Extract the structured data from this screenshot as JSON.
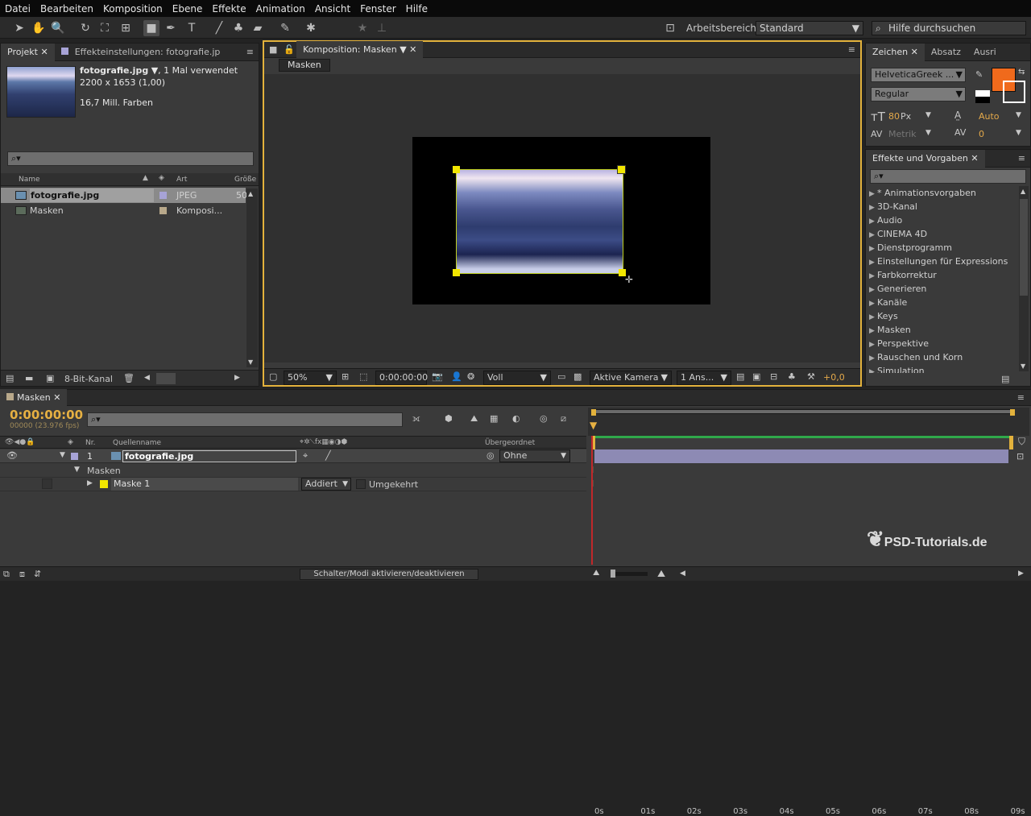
{
  "menu": [
    "Datei",
    "Bearbeiten",
    "Komposition",
    "Ebene",
    "Effekte",
    "Animation",
    "Ansicht",
    "Fenster",
    "Hilfe"
  ],
  "toolbar": {
    "workspace_label": "Arbeitsbereich:",
    "workspace_value": "Standard",
    "help_search_placeholder": "Hilfe durchsuchen"
  },
  "project": {
    "tab_label": "Projekt",
    "effects_tab_label": "Effekteinstellungen: fotografie.jp",
    "file_name": "fotografie.jpg",
    "usage": ", 1 Mal verwendet",
    "dimensions": "2200 x 1653 (1,00)",
    "colors": "16,7 Mill. Farben",
    "columns": {
      "name": "Name",
      "type": "Art",
      "size": "Größe"
    },
    "items": [
      {
        "name": "fotografie.jpg",
        "type": "JPEG",
        "size": "50",
        "color": "#a7a3d6"
      },
      {
        "name": "Masken",
        "type": "Komposi...",
        "size": "",
        "color": "#b8a88a"
      }
    ],
    "bit_depth": "8-Bit-Kanal"
  },
  "composition": {
    "tab_label": "Komposition: Masken",
    "breadcrumb": "Masken",
    "zoom": "50%",
    "timecode": "0:00:00:00",
    "resolution": "Voll",
    "camera": "Aktive Kamera",
    "views": "1 Ans...",
    "exposure": "+0,0"
  },
  "character": {
    "tabs": [
      "Zeichen",
      "Absatz",
      "Ausri"
    ],
    "font": "HelveticaGreek ...",
    "style": "Regular",
    "size": "80",
    "size_unit": "Px",
    "leading": "Auto",
    "kerning": "Metrik",
    "tracking": "0",
    "fill_color": "#f06a1c"
  },
  "effects": {
    "tab_label": "Effekte und Vorgaben",
    "items": [
      "* Animationsvorgaben",
      "3D-Kanal",
      "Audio",
      "CINEMA 4D",
      "Dienstprogramm",
      "Einstellungen für Expressions",
      "Farbkorrektur",
      "Generieren",
      "Kanäle",
      "Keys",
      "Masken",
      "Perspektive",
      "Rauschen und Korn",
      "Simulation"
    ]
  },
  "timeline": {
    "tab_label": "Masken",
    "timecode": "0:00:00:00",
    "frame_info": "00000 (23.976 fps)",
    "col_nr": "Nr.",
    "col_source": "Quellenname",
    "col_parent": "Übergeordnet",
    "layer_nr": "1",
    "layer_name": "fotografie.jpg",
    "parent_value": "Ohne",
    "masks_group": "Masken",
    "mask_name": "Maske 1",
    "mask_mode": "Addiert",
    "mask_inverted": "Umgekehrt",
    "mask_color": "#f2e600",
    "ticks": [
      "0s",
      "01s",
      "02s",
      "03s",
      "04s",
      "05s",
      "06s",
      "07s",
      "08s",
      "09s"
    ],
    "toggle_label": "Schalter/Modi aktivieren/deaktivieren"
  },
  "watermark": "PSD-Tutorials.de"
}
